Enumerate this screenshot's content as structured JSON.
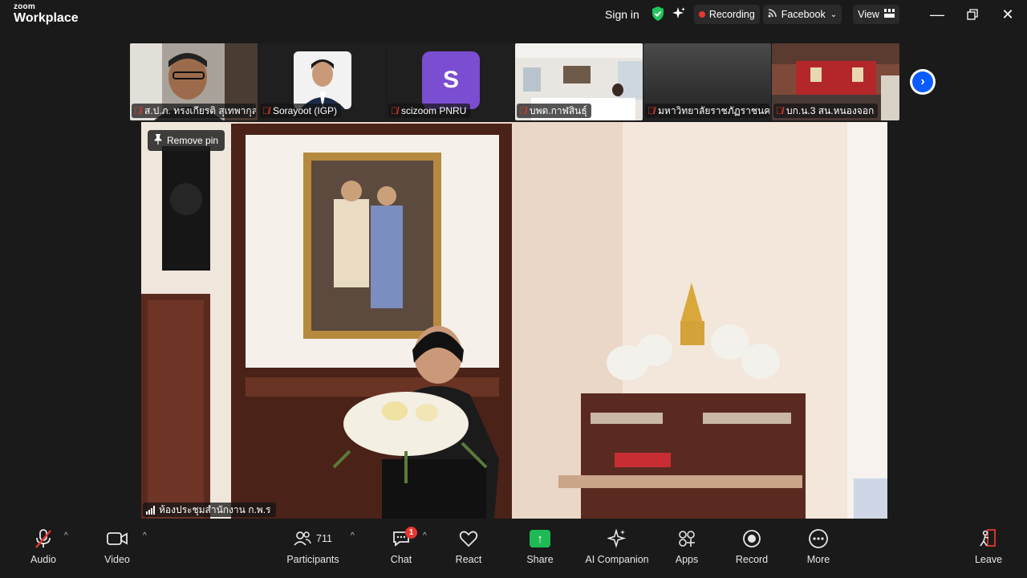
{
  "app": {
    "brand_small": "zoom",
    "brand_main": "Workplace"
  },
  "topbar": {
    "sign_in": "Sign in",
    "recording": "Recording",
    "livestream": "Facebook",
    "view": "View"
  },
  "gallery": [
    {
      "name": "ส.ป.ภ. ทรงเกียรติ สุเทพากุล",
      "muted": true
    },
    {
      "name": "Sorayoot (IGP)",
      "muted": true
    },
    {
      "name": "scizoom PNRU",
      "muted": true,
      "avatar_letter": "S"
    },
    {
      "name": "บพด.กาฬสินธุ์",
      "muted": true
    },
    {
      "name": "มหาวิทยาลัยราชภัฏราชนค...",
      "muted": true
    },
    {
      "name": "บก.น.3 สน.หนองจอก",
      "muted": true
    }
  ],
  "main_video": {
    "pin_label": "Remove pin",
    "speaker_name": "ห้องประชุมสำนักงาน ก.พ.ร"
  },
  "toolbar": {
    "audio": "Audio",
    "video": "Video",
    "participants": "Participants",
    "participants_count": "711",
    "chat": "Chat",
    "chat_badge": "1",
    "react": "React",
    "share": "Share",
    "ai_companion": "AI Companion",
    "apps": "Apps",
    "record": "Record",
    "more": "More",
    "leave": "Leave"
  },
  "colors": {
    "accent_blue": "#0b5cff",
    "share_green": "#1fb955",
    "muted_red": "#e5372f",
    "avatar_purple": "#7b4dd0"
  }
}
